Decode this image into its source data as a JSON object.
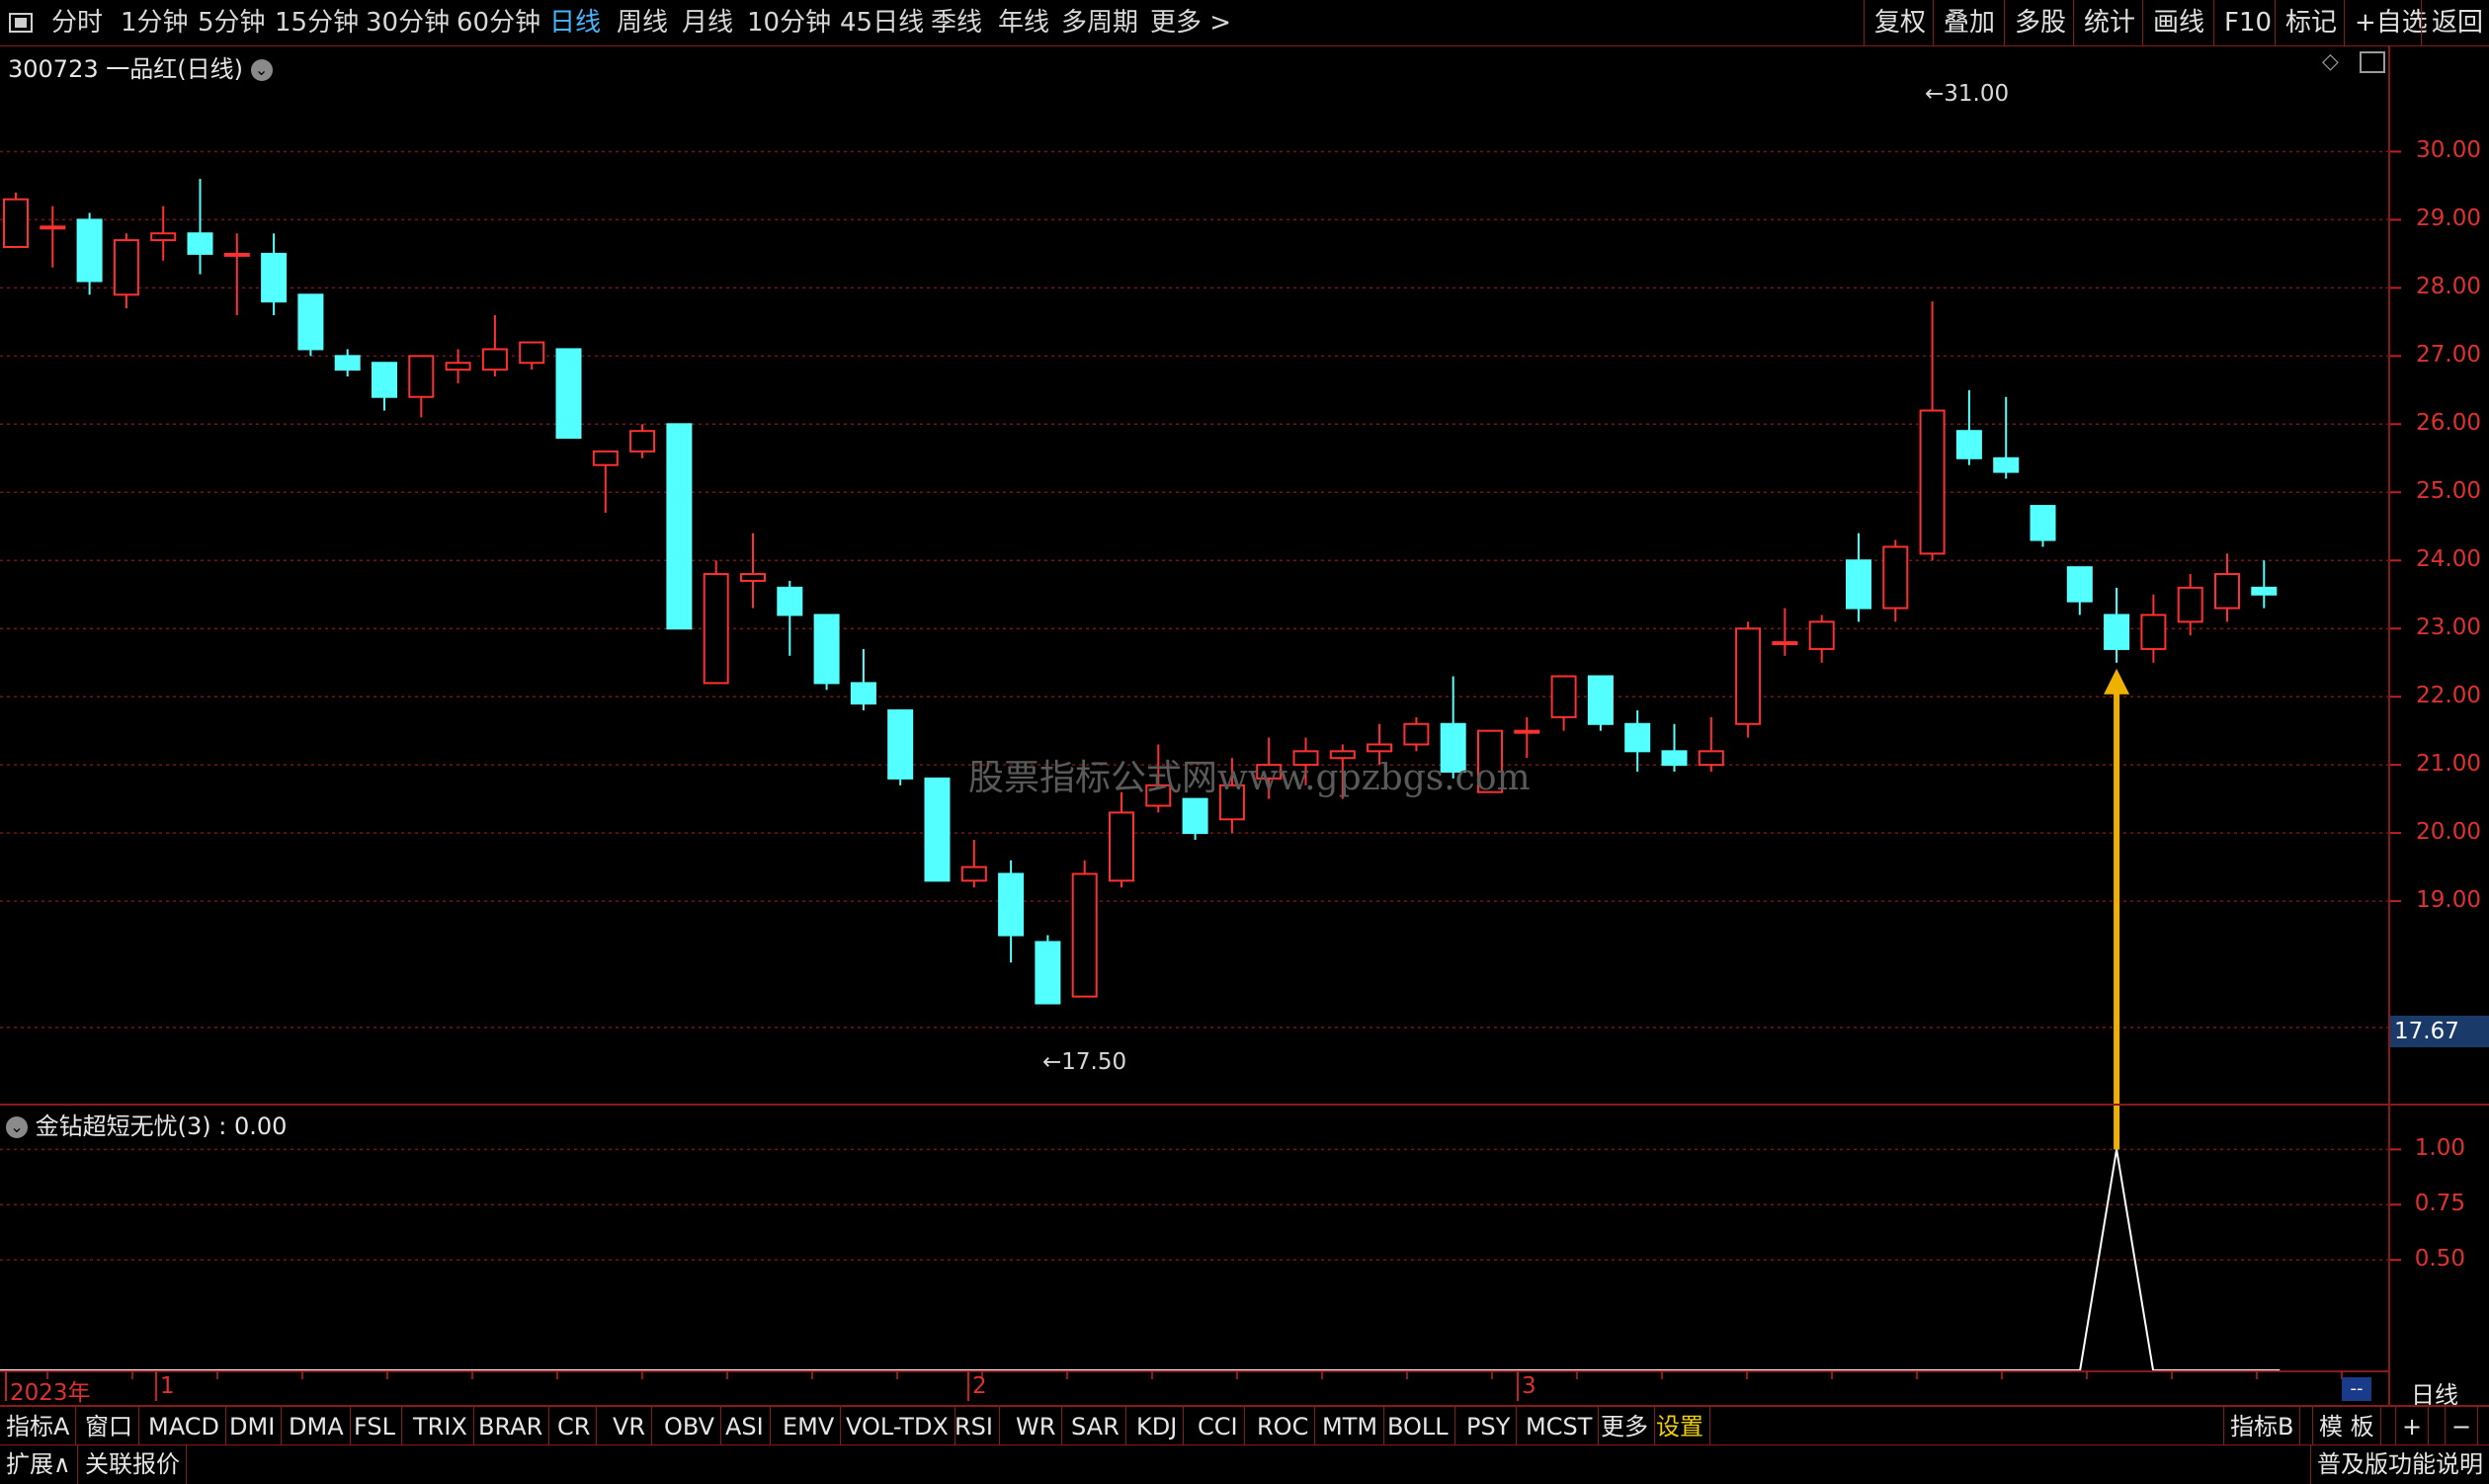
{
  "toolbar": {
    "periods": [
      "分时",
      "1分钟",
      "5分钟",
      "15分钟",
      "30分钟",
      "60分钟",
      "日线",
      "周线",
      "月线",
      "10分钟",
      "45日线",
      "季线",
      "年线",
      "多周期",
      "更多 >"
    ],
    "active_period": "日线",
    "right_buttons": [
      "复权",
      "叠加",
      "多股",
      "统计",
      "画线",
      "F10",
      "标记",
      "+自选",
      "返回"
    ]
  },
  "main_panel": {
    "title": "300723 一品红(日线)",
    "high_marker": "31.00",
    "low_marker": "17.50",
    "current_price": "17.67",
    "price_labels": [
      "30.00",
      "29.00",
      "28.00",
      "27.00",
      "26.00",
      "25.00",
      "24.00",
      "23.00",
      "22.00",
      "21.00",
      "20.00",
      "19.00"
    ]
  },
  "indicator_panel": {
    "title": "金钻超短无忧(3) : 0.00",
    "labels": [
      "1.00",
      "0.75",
      "0.50"
    ]
  },
  "date_axis": {
    "labels": [
      "2023年",
      "1",
      "2",
      "3"
    ],
    "period_label": "日线",
    "scroll_label": "--"
  },
  "watermark": "股票指标公式网www.gpzbgs.com",
  "indicator_tabs": [
    "指标A",
    "窗口",
    "MACD",
    "DMI",
    "DMA",
    "FSL",
    "TRIX",
    "BRAR",
    "CR",
    "VR",
    "OBV",
    "ASI",
    "EMV",
    "VOL-TDX",
    "RSI",
    "WR",
    "SAR",
    "KDJ",
    "CCI",
    "ROC",
    "MTM",
    "BOLL",
    "PSY",
    "MCST",
    "更多",
    "设置"
  ],
  "indicator_right": [
    "指标B",
    "模 板",
    "+",
    "−"
  ],
  "status_bar": {
    "expand": "扩展∧",
    "link": "关联报价",
    "right": "普及版功能说明"
  },
  "colors": {
    "up": "#ff3030",
    "down": "#54ffff",
    "grid": "#8a1a1a",
    "arrow": "#f0b000"
  },
  "chart_data": {
    "type": "candlestick",
    "ylim": [
      17.0,
      31.5
    ],
    "candles": [
      {
        "o": 28.6,
        "c": 29.3,
        "h": 29.4,
        "l": 28.7
      },
      {
        "o": 28.9,
        "c": 28.9,
        "h": 29.2,
        "l": 28.3
      },
      {
        "o": 29.0,
        "c": 28.1,
        "h": 29.1,
        "l": 27.9
      },
      {
        "o": 27.9,
        "c": 28.7,
        "h": 28.8,
        "l": 27.7
      },
      {
        "o": 28.7,
        "c": 28.8,
        "h": 29.2,
        "l": 28.4
      },
      {
        "o": 28.8,
        "c": 28.5,
        "h": 29.6,
        "l": 28.2
      },
      {
        "o": 28.5,
        "c": 28.5,
        "h": 28.8,
        "l": 27.6
      },
      {
        "o": 28.5,
        "c": 27.8,
        "h": 28.8,
        "l": 27.6
      },
      {
        "o": 27.9,
        "c": 27.1,
        "h": 27.9,
        "l": 27.0
      },
      {
        "o": 27.0,
        "c": 26.8,
        "h": 27.1,
        "l": 26.7
      },
      {
        "o": 26.9,
        "c": 26.4,
        "h": 26.9,
        "l": 26.2
      },
      {
        "o": 26.4,
        "c": 27.0,
        "h": 27.0,
        "l": 26.1
      },
      {
        "o": 26.8,
        "c": 26.9,
        "h": 27.1,
        "l": 26.6
      },
      {
        "o": 26.8,
        "c": 27.1,
        "h": 27.6,
        "l": 26.7
      },
      {
        "o": 26.9,
        "c": 27.2,
        "h": 27.2,
        "l": 26.8
      },
      {
        "o": 27.1,
        "c": 25.8,
        "h": 27.1,
        "l": 25.8
      },
      {
        "o": 25.4,
        "c": 25.6,
        "h": 25.6,
        "l": 24.7
      },
      {
        "o": 25.6,
        "c": 25.9,
        "h": 26.0,
        "l": 25.5
      },
      {
        "o": 26.0,
        "c": 23.0,
        "h": 26.0,
        "l": 23.0
      },
      {
        "o": 22.2,
        "c": 23.8,
        "h": 24.0,
        "l": 22.2
      },
      {
        "o": 23.7,
        "c": 23.8,
        "h": 24.4,
        "l": 23.3
      },
      {
        "o": 23.6,
        "c": 23.2,
        "h": 23.7,
        "l": 22.6
      },
      {
        "o": 23.2,
        "c": 22.2,
        "h": 23.2,
        "l": 22.1
      },
      {
        "o": 22.2,
        "c": 21.9,
        "h": 22.7,
        "l": 21.8
      },
      {
        "o": 21.8,
        "c": 20.8,
        "h": 21.8,
        "l": 20.7
      },
      {
        "o": 20.8,
        "c": 19.3,
        "h": 20.8,
        "l": 19.3
      },
      {
        "o": 19.3,
        "c": 19.5,
        "h": 19.9,
        "l": 19.2
      },
      {
        "o": 19.4,
        "c": 18.5,
        "h": 19.6,
        "l": 18.1
      },
      {
        "o": 18.4,
        "c": 17.5,
        "h": 18.5,
        "l": 17.5
      },
      {
        "o": 17.6,
        "c": 19.4,
        "h": 19.6,
        "l": 17.6
      },
      {
        "o": 19.3,
        "c": 20.3,
        "h": 20.6,
        "l": 19.2
      },
      {
        "o": 20.4,
        "c": 20.7,
        "h": 21.3,
        "l": 20.3
      },
      {
        "o": 20.5,
        "c": 20.0,
        "h": 20.5,
        "l": 19.9
      },
      {
        "o": 20.2,
        "c": 20.7,
        "h": 21.1,
        "l": 20.0
      },
      {
        "o": 20.8,
        "c": 21.0,
        "h": 21.4,
        "l": 20.5
      },
      {
        "o": 21.0,
        "c": 21.2,
        "h": 21.4,
        "l": 20.7
      },
      {
        "o": 21.1,
        "c": 21.2,
        "h": 21.3,
        "l": 20.5
      },
      {
        "o": 21.2,
        "c": 21.3,
        "h": 21.6,
        "l": 21.0
      },
      {
        "o": 21.3,
        "c": 21.6,
        "h": 21.7,
        "l": 21.2
      },
      {
        "o": 21.6,
        "c": 20.9,
        "h": 22.3,
        "l": 20.8
      },
      {
        "o": 20.6,
        "c": 21.5,
        "h": 21.5,
        "l": 20.6
      },
      {
        "o": 21.5,
        "c": 21.5,
        "h": 21.7,
        "l": 21.1
      },
      {
        "o": 21.7,
        "c": 22.3,
        "h": 22.3,
        "l": 21.5
      },
      {
        "o": 22.3,
        "c": 21.6,
        "h": 22.3,
        "l": 21.5
      },
      {
        "o": 21.6,
        "c": 21.2,
        "h": 21.8,
        "l": 20.9
      },
      {
        "o": 21.2,
        "c": 21.0,
        "h": 21.6,
        "l": 20.9
      },
      {
        "o": 21.0,
        "c": 21.2,
        "h": 21.7,
        "l": 20.9
      },
      {
        "o": 21.6,
        "c": 23.0,
        "h": 23.1,
        "l": 21.4
      },
      {
        "o": 22.8,
        "c": 22.8,
        "h": 23.3,
        "l": 22.6
      },
      {
        "o": 22.7,
        "c": 23.1,
        "h": 23.2,
        "l": 22.5
      },
      {
        "o": 24.0,
        "c": 23.3,
        "h": 24.4,
        "l": 23.1
      },
      {
        "o": 23.3,
        "c": 24.2,
        "h": 24.3,
        "l": 23.1
      },
      {
        "o": 24.1,
        "c": 26.2,
        "h": 27.8,
        "l": 24.0
      },
      {
        "o": 25.9,
        "c": 25.5,
        "h": 26.5,
        "l": 25.4
      },
      {
        "o": 25.5,
        "c": 25.3,
        "h": 26.4,
        "l": 25.2
      },
      {
        "o": 24.8,
        "c": 24.3,
        "h": 24.8,
        "l": 24.2
      },
      {
        "o": 23.9,
        "c": 23.4,
        "h": 23.9,
        "l": 23.2
      },
      {
        "o": 23.2,
        "c": 22.7,
        "h": 23.6,
        "l": 22.5
      },
      {
        "o": 22.7,
        "c": 23.2,
        "h": 23.5,
        "l": 22.5
      },
      {
        "o": 23.1,
        "c": 23.6,
        "h": 23.8,
        "l": 22.9
      },
      {
        "o": 23.3,
        "c": 23.8,
        "h": 24.1,
        "l": 23.1
      },
      {
        "o": 23.6,
        "c": 23.5,
        "h": 24.0,
        "l": 23.3
      }
    ],
    "indicator": {
      "name": "金钻超短无忧(3)",
      "signal_index": 57,
      "signal_value": 1.0,
      "ylim": [
        0,
        1.1
      ]
    }
  }
}
